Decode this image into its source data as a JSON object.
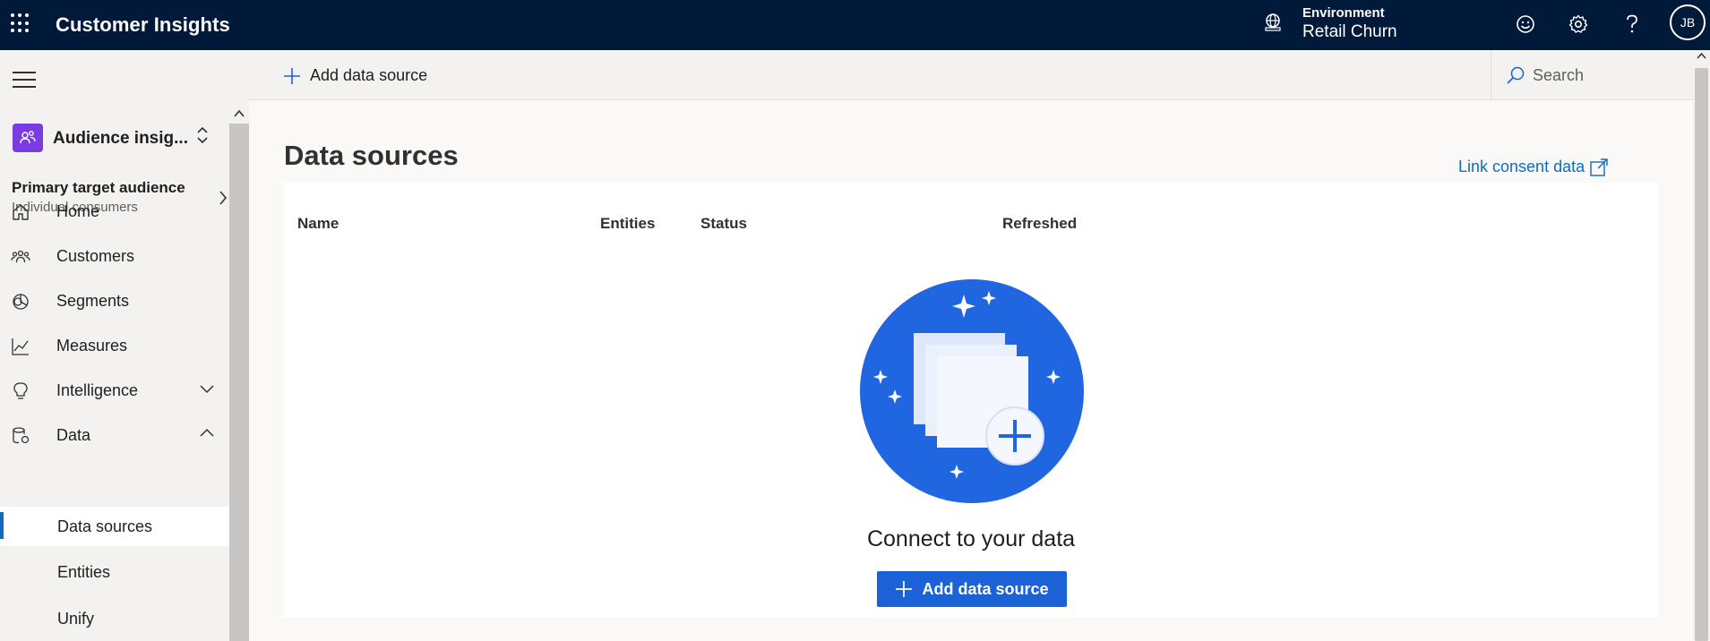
{
  "app": {
    "title": "Customer Insights"
  },
  "environment": {
    "label": "Environment",
    "value": "Retail Churn"
  },
  "user": {
    "initials": "JB"
  },
  "sidebar": {
    "workspace": "Audience insig...",
    "audience_title": "Primary target audience",
    "audience_subtitle": "Individual consumers",
    "nav": [
      {
        "label": "Home",
        "icon": "home-icon"
      },
      {
        "label": "Customers",
        "icon": "customers-icon"
      },
      {
        "label": "Segments",
        "icon": "segments-icon"
      },
      {
        "label": "Measures",
        "icon": "measures-icon"
      },
      {
        "label": "Intelligence",
        "icon": "lightbulb-icon",
        "expanded": false
      },
      {
        "label": "Data",
        "icon": "data-icon",
        "expanded": true
      }
    ],
    "sub_nav": [
      {
        "label": "Data sources",
        "active": true
      },
      {
        "label": "Entities",
        "active": false
      },
      {
        "label": "Unify",
        "active": false
      }
    ]
  },
  "command_bar": {
    "add_label": "Add data source",
    "search_placeholder": "Search"
  },
  "main": {
    "title": "Data sources",
    "link_consent": "Link consent data",
    "columns": [
      "Name",
      "Entities",
      "Status",
      "Refreshed"
    ],
    "empty_title": "Connect to your data",
    "empty_button": "Add data source"
  },
  "colors": {
    "topbar": "#021a3a",
    "accent": "#1a62d6",
    "illustration": "#2066e0",
    "workspace_icon": "#7a3be0"
  }
}
